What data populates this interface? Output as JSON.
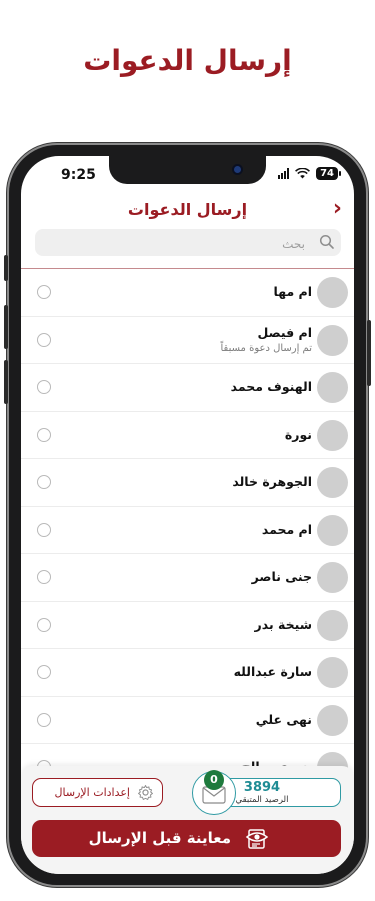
{
  "page_heading": "إرسال الدعوات",
  "status_bar": {
    "time": "9:25",
    "battery": "74"
  },
  "nav": {
    "title": "إرسال الدعوات"
  },
  "search": {
    "placeholder": "بحث"
  },
  "contacts": [
    {
      "name": "ام مها"
    },
    {
      "name": "ام فيصل",
      "sub": "تم إرسال دعوة مسبقاً"
    },
    {
      "name": "الهنوف محمد"
    },
    {
      "name": "نورة"
    },
    {
      "name": "الجوهرة خالد"
    },
    {
      "name": "ام محمد"
    },
    {
      "name": "جنى ناصر"
    },
    {
      "name": "شيخة بدر"
    },
    {
      "name": "سارة عبدالله"
    },
    {
      "name": "نهى علي"
    },
    {
      "name": "جوري صالح"
    }
  ],
  "bottom": {
    "settings_label": "إعدادات الإرسال",
    "balance_value": "3894",
    "balance_label": "الرصيد المتبقي",
    "selected_count": "0",
    "preview_label": "معاينة قبل الإرسال"
  },
  "colors": {
    "brand": "#9b1c23",
    "teal": "#2f9aa3",
    "badge_green": "#1e7a3d"
  },
  "icons": [
    "search-icon",
    "chevron-right-icon",
    "gear-icon",
    "envelope-icon",
    "eye-document-icon"
  ]
}
